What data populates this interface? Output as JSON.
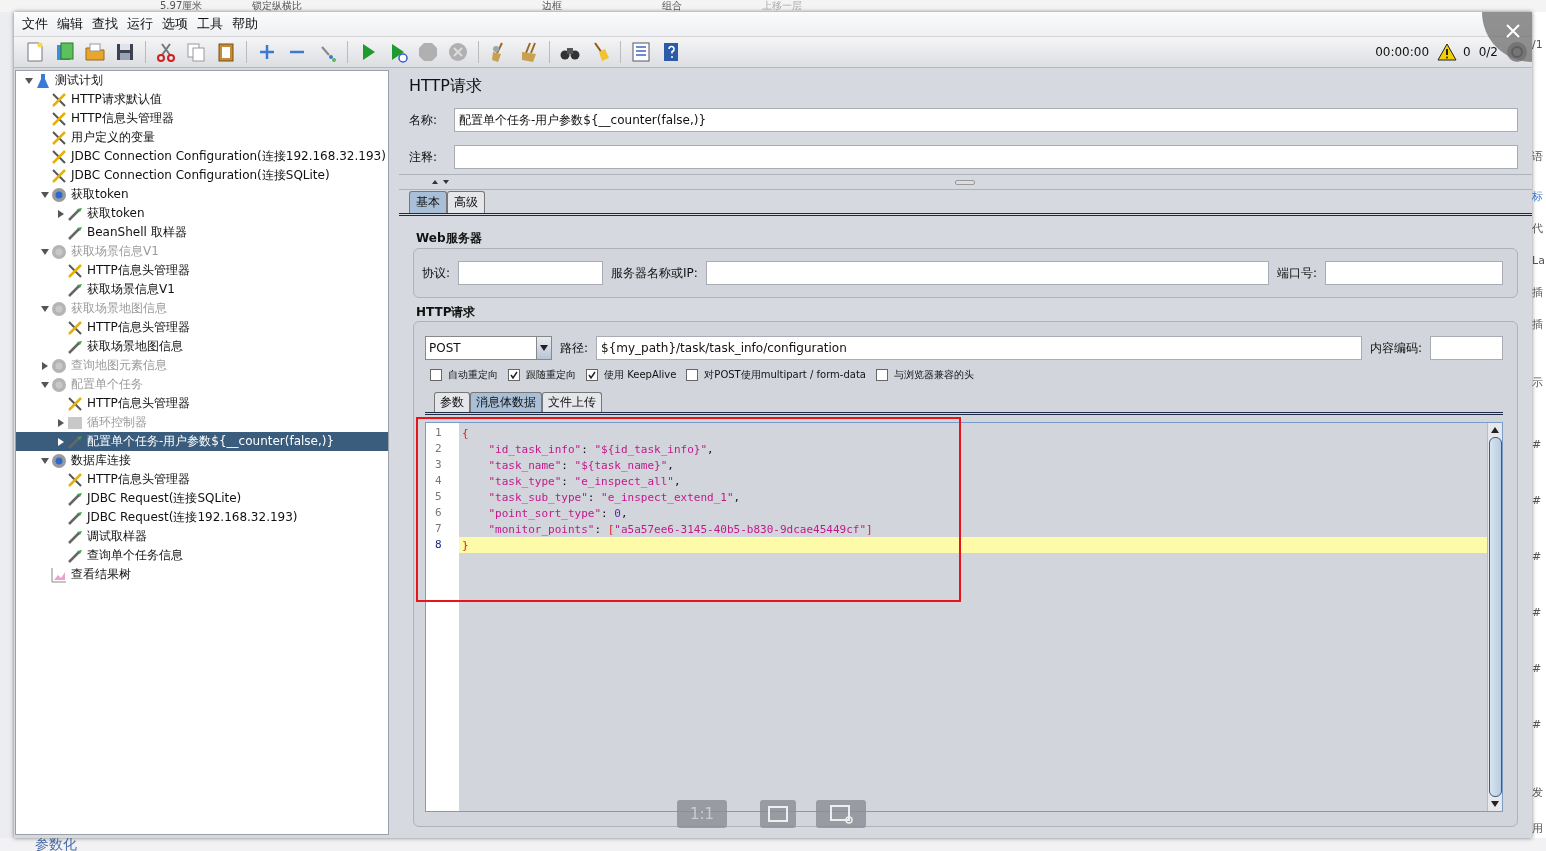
{
  "background_top": [
    "5.97厘米",
    "锁定纵横比",
    "边框",
    "组合",
    "上移一层"
  ],
  "background_right": [
    "/1",
    "语",
    "标",
    "代",
    "La",
    "插",
    "插",
    "示",
    "#",
    "#",
    "#",
    "#",
    "#",
    "#",
    "发",
    "用"
  ],
  "background_bottom": "参数化",
  "menu": [
    "文件",
    "编辑",
    "查找",
    "运行",
    "选项",
    "工具",
    "帮助"
  ],
  "status": {
    "time": "00:00:00",
    "warnings": "0",
    "threads": "0/2"
  },
  "tree": [
    {
      "label": "测试计划",
      "kind": "plan",
      "expanded": true,
      "disabled": false,
      "selected": false,
      "children": [
        {
          "label": "HTTP请求默认值",
          "kind": "config",
          "disabled": false,
          "selected": false
        },
        {
          "label": "HTTP信息头管理器",
          "kind": "config",
          "disabled": false,
          "selected": false
        },
        {
          "label": "用户定义的变量",
          "kind": "config",
          "disabled": false,
          "selected": false
        },
        {
          "label": "JDBC Connection Configuration(连接192.168.32.193)",
          "kind": "config",
          "disabled": false,
          "selected": false
        },
        {
          "label": "JDBC Connection Configuration(连接SQLite)",
          "kind": "config",
          "disabled": false,
          "selected": false
        },
        {
          "label": "获取token",
          "kind": "threadgroup",
          "expanded": true,
          "disabled": false,
          "selected": false,
          "children": [
            {
              "label": "获取token",
              "kind": "sampler",
              "expanded": false,
              "disabled": false,
              "selected": false
            },
            {
              "label": "BeanShell 取样器",
              "kind": "sampler",
              "disabled": false,
              "selected": false
            }
          ]
        },
        {
          "label": "获取场景信息V1",
          "kind": "threadgroup",
          "expanded": true,
          "disabled": true,
          "selected": false,
          "children": [
            {
              "label": "HTTP信息头管理器",
              "kind": "config",
              "disabled": false,
              "selected": false
            },
            {
              "label": "获取场景信息V1",
              "kind": "sampler",
              "disabled": false,
              "selected": false
            }
          ]
        },
        {
          "label": "获取场景地图信息",
          "kind": "threadgroup",
          "expanded": true,
          "disabled": true,
          "selected": false,
          "children": [
            {
              "label": "HTTP信息头管理器",
              "kind": "config",
              "disabled": false,
              "selected": false
            },
            {
              "label": "获取场景地图信息",
              "kind": "sampler",
              "disabled": false,
              "selected": false
            }
          ]
        },
        {
          "label": "查询地图元素信息",
          "kind": "threadgroup",
          "expanded": false,
          "disabled": true,
          "selected": false
        },
        {
          "label": "配置单个任务",
          "kind": "threadgroup",
          "expanded": true,
          "disabled": true,
          "selected": false,
          "children": [
            {
              "label": "HTTP信息头管理器",
              "kind": "config",
              "disabled": false,
              "selected": false
            },
            {
              "label": "循环控制器",
              "kind": "controller",
              "expanded": false,
              "disabled": true,
              "selected": false
            },
            {
              "label": "配置单个任务-用户参数${__counter(false,)}",
              "kind": "sampler",
              "expanded": false,
              "disabled": false,
              "selected": true
            }
          ]
        },
        {
          "label": "数据库连接",
          "kind": "threadgroup",
          "expanded": true,
          "disabled": false,
          "selected": false,
          "children": [
            {
              "label": "HTTP信息头管理器",
              "kind": "config",
              "disabled": false,
              "selected": false
            },
            {
              "label": "JDBC Request(连接SQLite)",
              "kind": "sampler",
              "disabled": false,
              "selected": false
            },
            {
              "label": "JDBC Request(连接192.168.32.193)",
              "kind": "sampler",
              "disabled": false,
              "selected": false
            },
            {
              "label": "调试取样器",
              "kind": "sampler",
              "disabled": false,
              "selected": false
            },
            {
              "label": "查询单个任务信息",
              "kind": "sampler",
              "disabled": false,
              "selected": false
            }
          ]
        },
        {
          "label": "查看结果树",
          "kind": "listener",
          "disabled": false,
          "selected": false
        }
      ]
    }
  ],
  "panel": {
    "title": "HTTP请求",
    "name_label": "名称:",
    "name_value": "配置单个任务-用户参数${__counter(false,)}",
    "comment_label": "注释:",
    "tabs": [
      {
        "label": "基本",
        "selected": true
      },
      {
        "label": "高级",
        "selected": false
      }
    ],
    "web_server": {
      "title": "Web服务器",
      "protocol_label": "协议:",
      "server_label": "服务器名称或IP:",
      "port_label": "端口号:"
    },
    "http_request": {
      "title": "HTTP请求",
      "method": "POST",
      "path_label": "路径:",
      "path_value": "${my_path}/task/task_info/configuration",
      "encoding_label": "内容编码:",
      "options": [
        {
          "label": "自动重定向",
          "checked": false
        },
        {
          "label": "跟随重定向",
          "checked": true
        },
        {
          "label": "使用 KeepAlive",
          "checked": true
        },
        {
          "label": "对POST使用multipart / form-data",
          "checked": false
        },
        {
          "label": "与浏览器兼容的头",
          "checked": false
        }
      ],
      "tabs": [
        {
          "label": "参数",
          "selected": false
        },
        {
          "label": "消息体数据",
          "selected": true
        },
        {
          "label": "文件上传",
          "selected": false
        }
      ],
      "body_lines": [
        {
          "number": "1",
          "code": "{",
          "current": false
        },
        {
          "number": "2",
          "code": "    \"id_task_info\": \"${id_task_info}\",",
          "current": false
        },
        {
          "number": "3",
          "code": "    \"task_name\": \"${task_name}\",",
          "current": false
        },
        {
          "number": "4",
          "code": "    \"task_type\": \"e_inspect_all\",",
          "current": false
        },
        {
          "number": "5",
          "code": "    \"task_sub_type\": \"e_inspect_extend_1\",",
          "current": false
        },
        {
          "number": "6",
          "code": "    \"point_sort_type\": 0,",
          "current": false
        },
        {
          "number": "7",
          "code": "    \"monitor_points\": [\"a5a57ee6-3145-40b5-b830-9dcae45449cf\"]",
          "current": false
        },
        {
          "number": "8",
          "code": "}",
          "current": true
        }
      ]
    }
  },
  "viewer": {
    "zoom_label": "1:1"
  }
}
